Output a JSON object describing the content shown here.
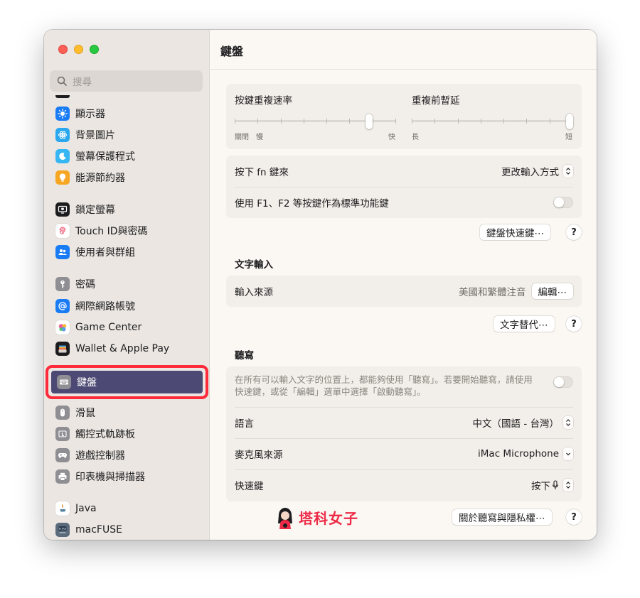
{
  "sidebar": {
    "search_placeholder": "搜尋",
    "items": [
      {
        "label": "顯示器",
        "icon": "display-icon",
        "color": "#1a7cf5"
      },
      {
        "label": "背景圖片",
        "icon": "wallpaper-icon",
        "color": "#29a8f0"
      },
      {
        "label": "螢幕保護程式",
        "icon": "screensaver-icon",
        "color": "#36b6f2"
      },
      {
        "label": "能源節約器",
        "icon": "lightbulb-icon",
        "color": "#f6a623"
      },
      {
        "label": "鎖定螢幕",
        "icon": "lock-screen-icon",
        "color": "#1d1d1f"
      },
      {
        "label": "Touch ID與密碼",
        "icon": "fingerprint-icon",
        "color": "#ffffff"
      },
      {
        "label": "使用者與群組",
        "icon": "users-icon",
        "color": "#1a7cf5"
      },
      {
        "label": "密碼",
        "icon": "key-icon",
        "color": "#8e8e93"
      },
      {
        "label": "網際網路帳號",
        "icon": "at-icon",
        "color": "#1a7cf5"
      },
      {
        "label": "Game Center",
        "icon": "game-center-icon",
        "color": "#ffffff"
      },
      {
        "label": "Wallet & Apple Pay",
        "icon": "wallet-icon",
        "color": "#1d1d1f"
      },
      {
        "label": "鍵盤",
        "icon": "keyboard-icon",
        "color": "#8e8e93"
      },
      {
        "label": "滑鼠",
        "icon": "mouse-icon",
        "color": "#8e8e93"
      },
      {
        "label": "觸控式軌跡板",
        "icon": "trackpad-icon",
        "color": "#8e8e93"
      },
      {
        "label": "遊戲控制器",
        "icon": "gamepad-icon",
        "color": "#8e8e93"
      },
      {
        "label": "印表機與掃描器",
        "icon": "printer-icon",
        "color": "#8e8e93"
      },
      {
        "label": "Java",
        "icon": "java-icon",
        "color": "#ffffff"
      },
      {
        "label": "macFUSE",
        "icon": "macfuse-icon",
        "color": "#5b6b7c"
      }
    ]
  },
  "main": {
    "title": "鍵盤",
    "key_repeat": {
      "label": "按鍵重複速率",
      "min_label": "關閉",
      "slow_label": "慢",
      "max_label": "快",
      "value": 0.85
    },
    "repeat_delay": {
      "label": "重複前暫延",
      "min_label": "長",
      "max_label": "短",
      "value": 1.0
    },
    "fn_key": {
      "label": "按下 fn 鍵來",
      "value": "更改輸入方式"
    },
    "f_keys": {
      "label": "使用 F1、F2 等按鍵作為標準功能鍵"
    },
    "shortcuts_button": "鍵盤快速鍵⋯",
    "help": "?",
    "text_input": {
      "section": "文字輸入",
      "label": "輸入來源",
      "value": "美國和繁體注音",
      "edit_button": "編輯⋯",
      "replace_button": "文字替代⋯"
    },
    "dictation": {
      "section": "聽寫",
      "description": "在所有可以輸入文字的位置上，都能夠使用「聽寫」。若要開始聽寫，請使用快速鍵，或從「編輯」選單中選擇「啟動聽寫」。",
      "language_label": "語言",
      "language_value": "中文（國語 - 台灣）",
      "mic_label": "麥克風來源",
      "mic_value": "iMac Microphone",
      "shortcut_label": "快速鍵",
      "shortcut_value": "按下",
      "about_button": "關於聽寫與隱私權⋯"
    },
    "watermark": "塔科女子"
  }
}
